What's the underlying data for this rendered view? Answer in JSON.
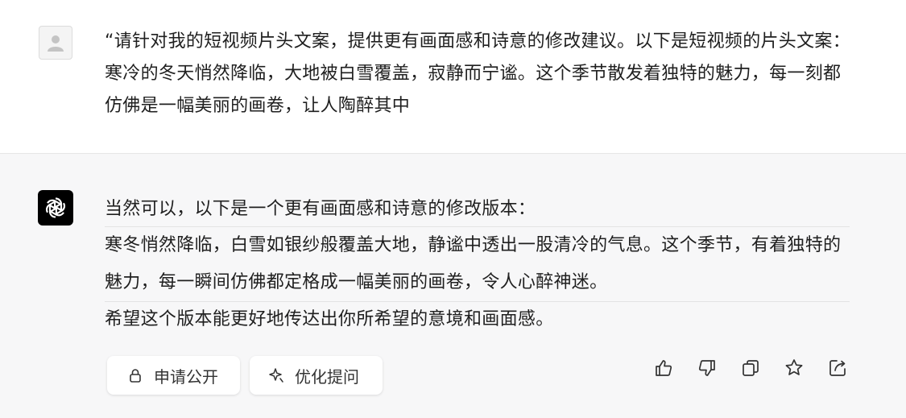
{
  "user_message": {
    "text": "“请针对我的短视频片头文案，提供更有画面感和诗意的修改建议。以下是短视频的片头文案：寒冷的冬天悄然降临，大地被白雪覆盖，寂静而宁谧。这个季节散发着独特的魅力，每一刻都仿佛是一幅美丽的画卷，让人陶醉其中"
  },
  "assistant_message": {
    "intro": "当然可以，以下是一个更有画面感和诗意的修改版本：",
    "revised": "寒冬悄然降临，白雪如银纱般覆盖大地，静谧中透出一股清冷的气息。这个季节，有着独特的魅力，每一瞬间仿佛都定格成一幅美丽的画卷，令人心醉神迷。",
    "closing": "希望这个版本能更好地传达出你所希望的意境和画面感。"
  },
  "actions": {
    "apply_public_label": "申请公开",
    "optimize_prompt_label": "优化提问"
  },
  "icons": {
    "user_avatar": "user-avatar-icon",
    "assistant_avatar": "openai-logo-icon",
    "lock": "lock-icon",
    "sparkle": "sparkle-icon",
    "thumbs_up": "thumbs-up-icon",
    "thumbs_down": "thumbs-down-icon",
    "copy": "copy-icon",
    "star": "star-icon",
    "share": "share-icon"
  },
  "colors": {
    "assistant_bg": "#f7f7f8",
    "avatar_bg": "#000000",
    "text": "#1f1f1f"
  }
}
